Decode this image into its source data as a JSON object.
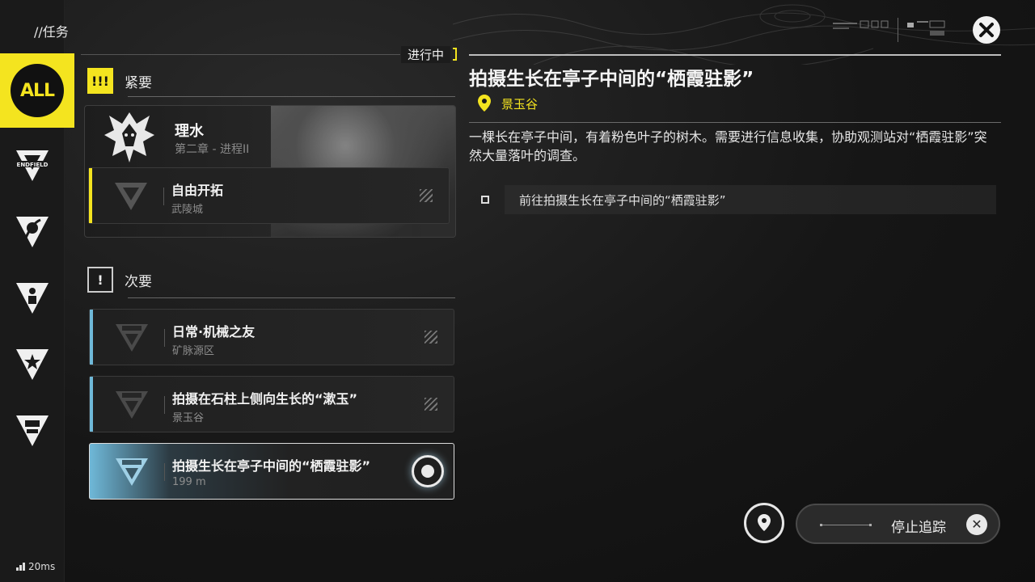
{
  "header": {
    "title": "//任务",
    "close_icon": "close-icon"
  },
  "rail": {
    "all_label": "ALL",
    "items": [
      {
        "icon": "endfield-icon",
        "label": "ENDFIELD"
      },
      {
        "icon": "swirl-icon"
      },
      {
        "icon": "person-icon"
      },
      {
        "icon": "star-icon"
      },
      {
        "icon": "crate-icon"
      }
    ]
  },
  "status": {
    "ping": "20ms"
  },
  "list": {
    "in_progress_label": "进行中",
    "urgent": {
      "label": "紧要",
      "badge": "!!!",
      "main": {
        "title": "理水",
        "subtitle": "第二章 - 进程II"
      },
      "quests": [
        {
          "title": "自由开拓",
          "subtitle": "武陵城"
        }
      ]
    },
    "secondary": {
      "label": "次要",
      "badge": "!",
      "quests": [
        {
          "title": "日常·机械之友",
          "subtitle": "矿脉源区"
        },
        {
          "title": "拍摄在石柱上侧向生长的“漱玉”",
          "subtitle": "景玉谷"
        },
        {
          "title": "拍摄生长在亭子中间的“栖霞驻影”",
          "subtitle": "199 m"
        }
      ]
    }
  },
  "detail": {
    "title": "拍摄生长在亭子中间的“栖霞驻影”",
    "location": "景玉谷",
    "description": "一棵长在亭子中间，有着粉色叶子的树木。需要进行信息收集，协助观测站对“栖霞驻影”突然大量落叶的调查。",
    "objective": "前往拍摄生长在亭子中间的“栖霞驻影”"
  },
  "actions": {
    "stop_tracking": "停止追踪"
  },
  "colors": {
    "accent": "#f4e41f",
    "secondary_bar": "#6fb8d8"
  }
}
